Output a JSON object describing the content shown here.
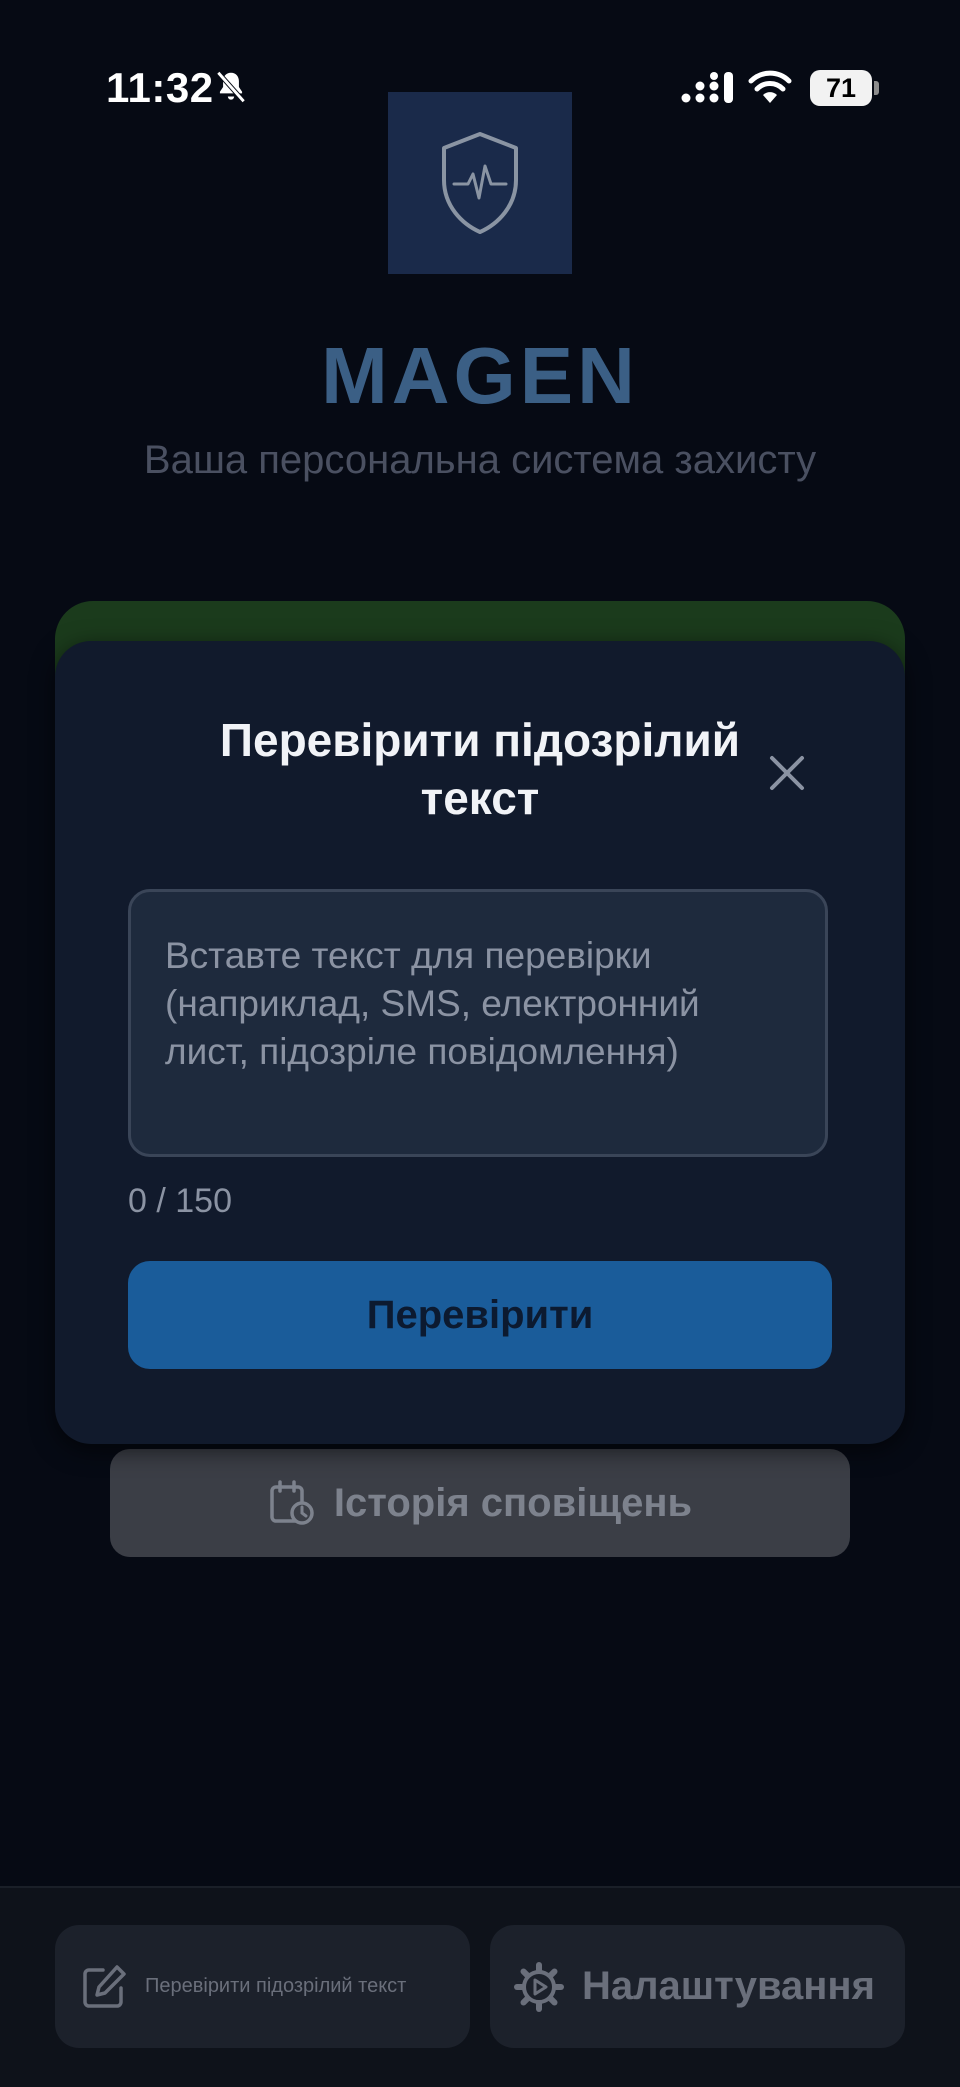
{
  "status_bar": {
    "time": "11:32",
    "battery_level": "71",
    "icons": [
      "bell-slash-icon",
      "cellular-signal-icon",
      "wifi-icon",
      "battery-icon"
    ]
  },
  "app": {
    "logo_icon": "shield-pulse-icon",
    "title": "MAGEN",
    "subtitle": "Ваша персональна система захисту"
  },
  "modal": {
    "title": "Перевірити підозрілий текст",
    "close_icon": "close-icon",
    "input_placeholder": "Вставте текст для перевірки (наприклад, SMS, електронний лист, підозріле повідомлення)",
    "char_count": "0 / 150",
    "submit_label": "Перевірити"
  },
  "history_button": {
    "icon": "calendar-clock-icon",
    "label": "Історія сповіщень"
  },
  "bottom_nav": {
    "check_text": {
      "icon": "edit-icon",
      "label": "Перевірити підозрілий текст"
    },
    "settings": {
      "icon": "gear-icon",
      "label": "Налаштування"
    }
  },
  "colors": {
    "background": "#060a14",
    "accent_blue": "#1a5c9a",
    "title_blue": "#3b5f85",
    "success_green": "#1b3b1c",
    "modal_bg": "#111a2c"
  }
}
